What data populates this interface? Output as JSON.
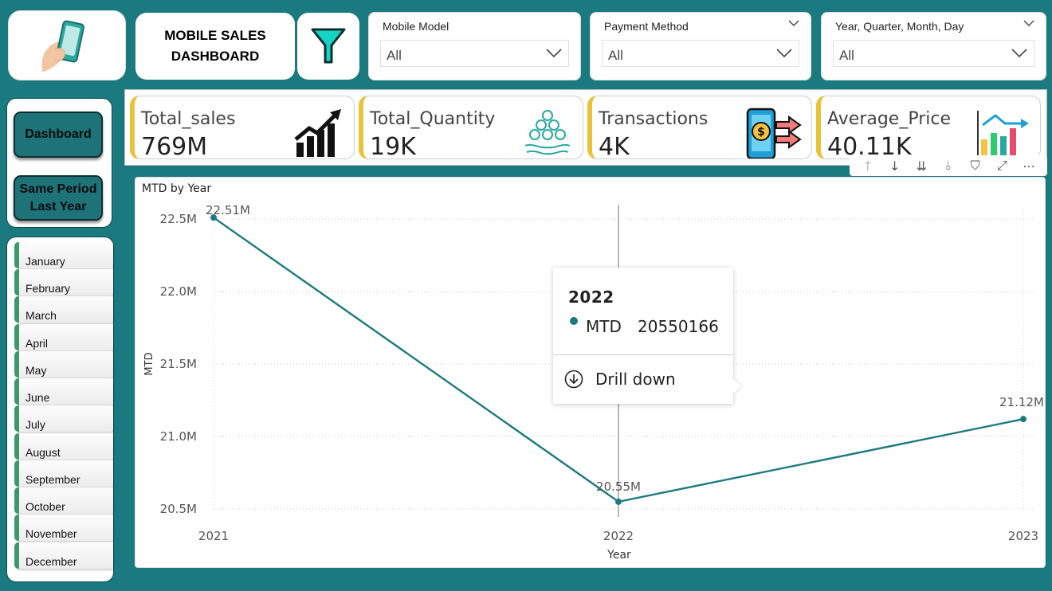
{
  "header": {
    "title": "MOBILE SALES\nDASHBOARD",
    "logo_icon": "phone-in-hand-icon",
    "filter_icon": "funnel-icon"
  },
  "slicers": [
    {
      "label": "Mobile Model",
      "value": "All"
    },
    {
      "label": "Payment Method",
      "value": "All"
    },
    {
      "label": "Year, Quarter, Month, Day",
      "value": "All"
    }
  ],
  "nav": {
    "dashboard_label": "Dashboard",
    "same_period_label": "Same Period Last Year"
  },
  "months": [
    "January",
    "February",
    "March",
    "April",
    "May",
    "June",
    "July",
    "August",
    "September",
    "October",
    "November",
    "December"
  ],
  "kpis": [
    {
      "label": "Total_sales",
      "value": "769M",
      "icon": "rising-bar-chart-icon"
    },
    {
      "label": "Total_Quantity",
      "value": "19K",
      "icon": "coins-in-hand-icon"
    },
    {
      "label": "Transactions",
      "value": "4K",
      "icon": "mobile-payment-icon"
    },
    {
      "label": "Average_Price",
      "value": "40.11K",
      "icon": "colored-bar-trend-icon"
    }
  ],
  "toolbar": [
    "↑",
    "↓",
    "⇊",
    "⫰",
    "⛉",
    "⤢",
    "⋯"
  ],
  "colors": {
    "teal": "#1b7a80",
    "accent_yellow": "#e8c33a",
    "month_green": "#3a9a6a"
  },
  "chart_data": {
    "type": "line",
    "title": "MTD by Year",
    "xlabel": "Year",
    "ylabel": "MTD",
    "categories": [
      "2021",
      "2022",
      "2023"
    ],
    "series": [
      {
        "name": "MTD",
        "values": [
          22510000,
          20550166,
          21120000
        ]
      }
    ],
    "data_labels": [
      "22.51M",
      "20.55M",
      "21.12M"
    ],
    "yticks": [
      20500000,
      21000000,
      21500000,
      22000000,
      22500000
    ],
    "ytick_labels": [
      "20.5M",
      "21.0M",
      "21.5M",
      "22.0M",
      "22.5M"
    ],
    "ylim": [
      20500000,
      22500000
    ],
    "grid": true,
    "highlight_index": 1
  },
  "tooltip": {
    "year": "2022",
    "measure": "MTD",
    "value": "20550166",
    "drill_label": "Drill down"
  }
}
